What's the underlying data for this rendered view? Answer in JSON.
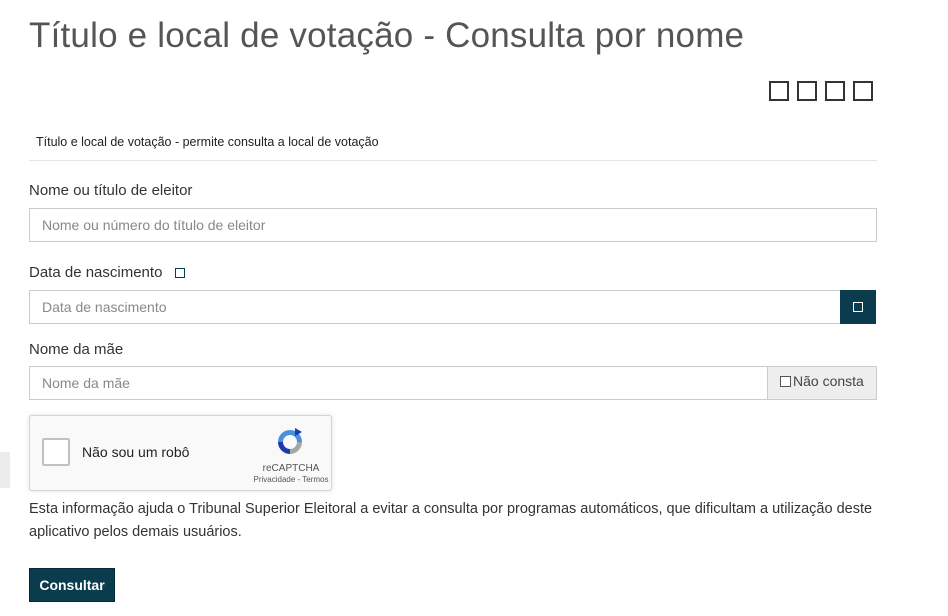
{
  "page": {
    "title": "Título e local de votação - Consulta por nome",
    "description": "Título e local de votação - permite consulta a local de votação"
  },
  "toolbar": {
    "icons": [
      "square-icon",
      "square-icon",
      "square-icon",
      "square-icon"
    ]
  },
  "form": {
    "name_field": {
      "label": "Nome ou título de eleitor",
      "placeholder": "Nome ou número do título de eleitor",
      "value": ""
    },
    "birthdate_field": {
      "label": "Data de nascimento",
      "placeholder": "Data de nascimento",
      "value": "",
      "help_icon": "square-icon",
      "calendar_icon": "square-icon"
    },
    "mother_field": {
      "label": "Nome da mãe",
      "placeholder": "Nome da mãe",
      "value": "",
      "checkbox_label": "Não consta",
      "checked": false
    }
  },
  "captcha": {
    "label": "Não sou um robô",
    "brand": "reCAPTCHA",
    "privacy_link": "Privacidade",
    "separator": " - ",
    "terms_link": "Termos",
    "checked": false
  },
  "info": {
    "text": "Esta informação ajuda o Tribunal Superior Eleitoral a evitar a consulta por programas automáticos, que dificultam a utilização deste aplicativo pelos demais usuários."
  },
  "actions": {
    "submit_label": "Consultar"
  },
  "colors": {
    "primary": "#0b3c4d",
    "title": "#555555",
    "border": "#cccccc"
  }
}
